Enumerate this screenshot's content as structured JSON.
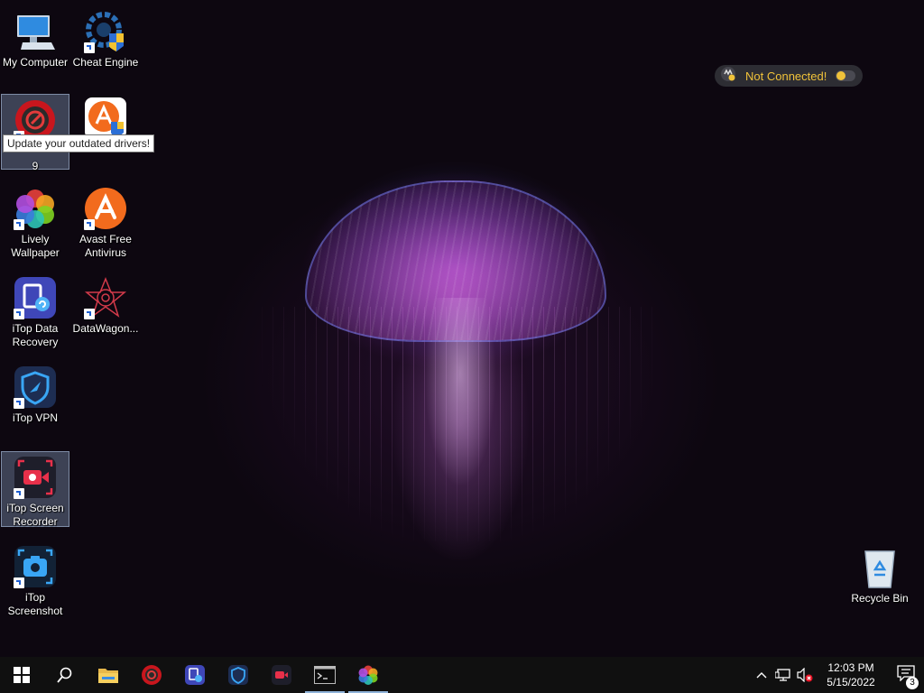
{
  "desktop": {
    "tooltip": "Update your outdated drivers!",
    "icons": [
      {
        "label": "My Computer"
      },
      {
        "label": "Cheat Engine"
      },
      {
        "label": "9"
      },
      {
        "label": ""
      },
      {
        "label": "Lively\nWallpaper"
      },
      {
        "label": "Avast Free\nAntivirus"
      },
      {
        "label": "iTop Data\nRecovery"
      },
      {
        "label": "DataWagon..."
      },
      {
        "label": "iTop VPN"
      },
      {
        "label": "iTop Screen\nRecorder"
      },
      {
        "label": "iTop\nScreenshot"
      },
      {
        "label": "Recycle Bin"
      }
    ]
  },
  "vpn_widget": {
    "status": "Not Connected!",
    "status_color": "#f0c23a"
  },
  "taskbar": {
    "items": [
      {
        "icon": "windows-start-icon"
      },
      {
        "icon": "search-icon"
      },
      {
        "icon": "file-explorer-icon"
      },
      {
        "icon": "driver-booster-icon"
      },
      {
        "icon": "itop-data-recovery-icon"
      },
      {
        "icon": "itop-vpn-icon"
      },
      {
        "icon": "itop-screen-recorder-icon"
      },
      {
        "icon": "command-prompt-icon"
      },
      {
        "icon": "lively-wallpaper-icon"
      }
    ],
    "tray": {
      "time": "12:03 PM",
      "date": "5/15/2022",
      "notification_count": "3"
    }
  }
}
